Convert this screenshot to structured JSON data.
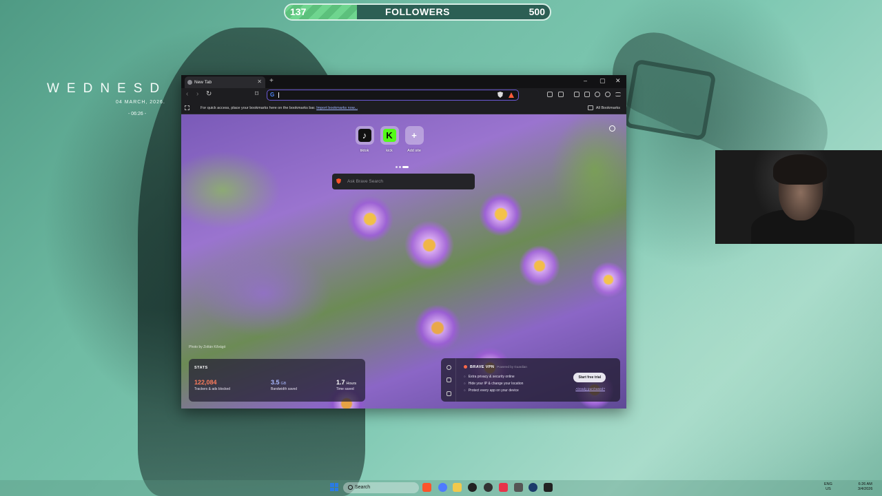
{
  "overlay": {
    "followers": {
      "current": "137",
      "label": "FOLLOWERS",
      "goal": "500",
      "progress_fraction": 0.27
    }
  },
  "desktop_widget": {
    "day": "WEDNESD",
    "date": "04 MARCH, 2026.",
    "time": "- 06:26 -"
  },
  "browser": {
    "tab_title": "New Tab",
    "new_tab_button": "+",
    "window_controls": {
      "minimize": "–",
      "maximize": "▢",
      "close": "✕"
    },
    "nav": {
      "back": "‹",
      "forward": "›",
      "reload": "↻",
      "bookmark": "⌑"
    },
    "address_bar": {
      "value": "",
      "search_engine_glyph": "G"
    },
    "bookmarks_bar": {
      "message": "For quick access, place your bookmarks here on the bookmarks bar.",
      "import_link": "Import bookmarks now...",
      "all_bookmarks": "All Bookmarks"
    },
    "accent_color": "#6c5ad8"
  },
  "new_tab_page": {
    "top_sites": [
      {
        "label": "tiktok",
        "icon": "tiktok-icon",
        "glyph": "♪",
        "bg": "#111111",
        "fg": "#ffffff"
      },
      {
        "label": "kick",
        "icon": "kick-icon",
        "glyph": "K",
        "bg": "#53fc18",
        "fg": "#0a0a0a"
      },
      {
        "label": "Add site",
        "icon": "plus-icon",
        "glyph": "+",
        "bg": "transparent",
        "fg": "#ffffff"
      }
    ],
    "search_placeholder": "Ask Brave Search",
    "photo_credit": "Photo by Zoltán Kővágó",
    "stats": {
      "heading": "STATS",
      "trackers": {
        "value": "122,084",
        "unit": "",
        "label": "Trackers & ads blocked",
        "color": "#fb7b5c"
      },
      "bandwidth": {
        "value": "3.5",
        "unit": "GB",
        "label": "Bandwidth saved",
        "color": "#a9b8ff"
      },
      "time": {
        "value": "1.7",
        "unit": "Hours",
        "label": "Time saved",
        "color": "#ffffff"
      }
    },
    "vpn": {
      "title": "BRAVE VPN",
      "powered_by": "Powered by Guardian",
      "features": [
        "Extra privacy & security online",
        "Hide your IP & change your location",
        "Protect every app on your device"
      ],
      "cta": "Start free trial",
      "purchased_link": "Already purchased?"
    }
  },
  "taskbar": {
    "search_label": "Search",
    "tray": {
      "lang": "ENG",
      "region": "US",
      "time": "6:26 AM",
      "date": "3/4/2026"
    }
  }
}
